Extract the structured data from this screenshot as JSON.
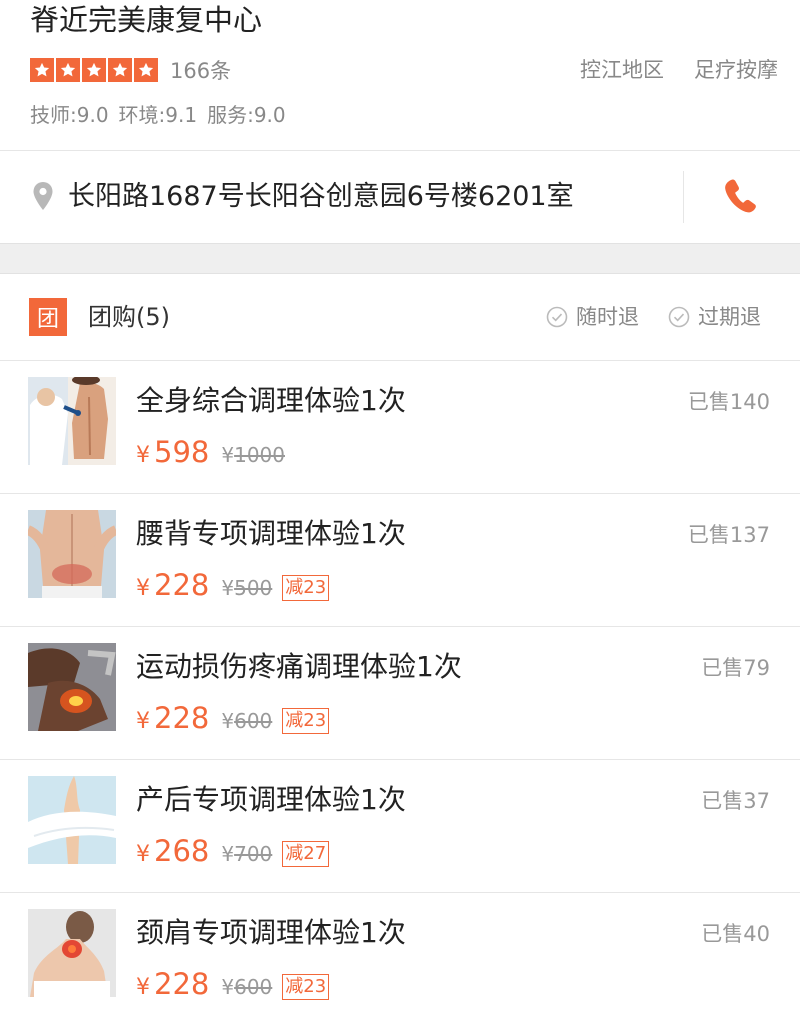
{
  "shop": {
    "name": "脊近完美康复中心",
    "review_count": "166条",
    "district": "控江地区",
    "category": "足疗按摩",
    "scores": [
      "技师:9.0",
      "环境:9.1",
      "服务:9.0"
    ],
    "stars": 5
  },
  "address": {
    "text": "长阳路1687号长阳谷创意园6号楼6201室",
    "location_icon": "map-pin-icon",
    "phone_icon": "phone-icon"
  },
  "group": {
    "badge": "团",
    "title": "团购(5)",
    "policies": [
      "随时退",
      "过期退"
    ]
  },
  "deals": [
    {
      "title": "全身综合调理体验1次",
      "sold": "已售140",
      "currency": "¥",
      "price": "598",
      "original_currency": "¥",
      "original": "1000",
      "discount": ""
    },
    {
      "title": "腰背专项调理体验1次",
      "sold": "已售137",
      "currency": "¥",
      "price": "228",
      "original_currency": "¥",
      "original": "500",
      "discount": "减23"
    },
    {
      "title": "运动损伤疼痛调理体验1次",
      "sold": "已售79",
      "currency": "¥",
      "price": "228",
      "original_currency": "¥",
      "original": "600",
      "discount": "减23"
    },
    {
      "title": "产后专项调理体验1次",
      "sold": "已售37",
      "currency": "¥",
      "price": "268",
      "original_currency": "¥",
      "original": "700",
      "discount": "减27"
    },
    {
      "title": "颈肩专项调理体验1次",
      "sold": "已售40",
      "currency": "¥",
      "price": "228",
      "original_currency": "¥",
      "original": "600",
      "discount": "减23"
    }
  ],
  "colors": {
    "accent": "#f2683a",
    "muted": "#888888",
    "divider": "#e6e6e6"
  }
}
